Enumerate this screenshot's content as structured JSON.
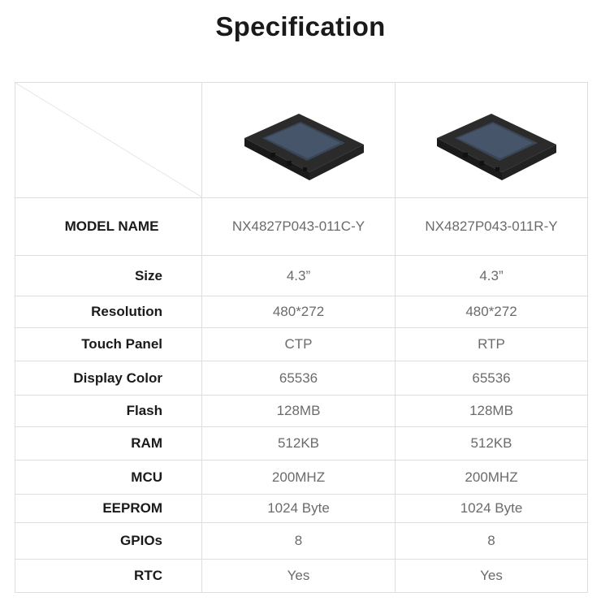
{
  "title": "Specification",
  "products": [
    {
      "image": "lcd-display-module",
      "model": "NX4827P043-011C-Y"
    },
    {
      "image": "lcd-display-module",
      "model": "NX4827P043-011R-Y"
    }
  ],
  "header_label": "MODEL NAME",
  "rows": [
    {
      "label": "Size",
      "values": [
        "4.3”",
        "4.3”"
      ]
    },
    {
      "label": "Resolution",
      "values": [
        "480*272",
        "480*272"
      ]
    },
    {
      "label": "Touch Panel",
      "values": [
        "CTP",
        "RTP"
      ]
    },
    {
      "label": "Display Color",
      "values": [
        "65536",
        "65536"
      ]
    },
    {
      "label": "Flash",
      "values": [
        "128MB",
        "128MB"
      ]
    },
    {
      "label": "RAM",
      "values": [
        "512KB",
        "512KB"
      ]
    },
    {
      "label": "MCU",
      "values": [
        "200MHZ",
        "200MHZ"
      ]
    },
    {
      "label": "EEPROM",
      "values": [
        "1024 Byte",
        "1024 Byte"
      ]
    },
    {
      "label": "GPIOs",
      "values": [
        "8",
        "8"
      ]
    },
    {
      "label": "RTC",
      "values": [
        "Yes",
        "Yes"
      ]
    }
  ]
}
